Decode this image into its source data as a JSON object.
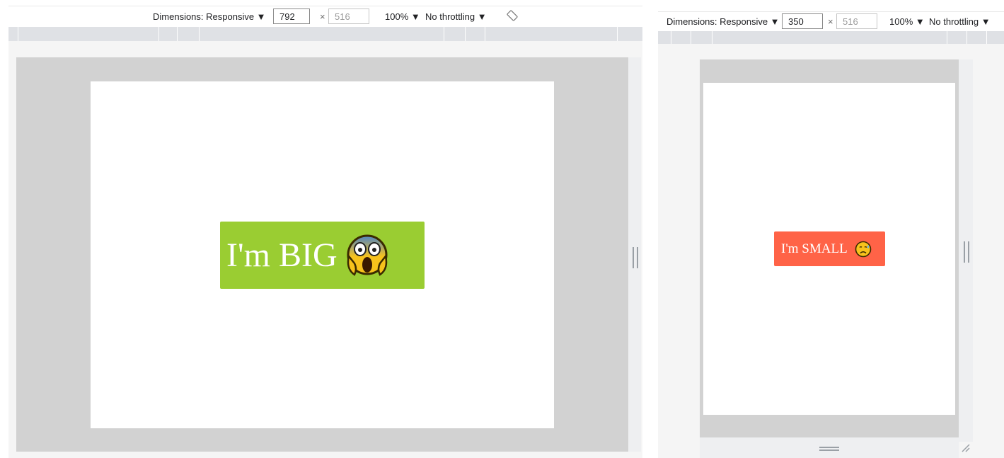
{
  "left_device": {
    "dimensions_label": "Dimensions: Responsive ▼",
    "width_value": "792",
    "height_value": "516",
    "times_symbol": "×",
    "zoom_label": "100% ▼",
    "throttle_label": "No throttling ▼",
    "rotate_icon": "rotate-icon",
    "badge": {
      "text": "I'm BIG",
      "emoji": "face-screaming-in-fear",
      "color": "#9acd32"
    }
  },
  "right_device": {
    "dimensions_label": "Dimensions: Responsive ▼",
    "width_value": "350",
    "height_value": "516",
    "times_symbol": "×",
    "zoom_label": "100% ▼",
    "throttle_label": "No throttling ▼",
    "badge": {
      "text": "I'm SMALL",
      "emoji": "sad-but-relieved-face",
      "color": "#ff6347"
    }
  }
}
